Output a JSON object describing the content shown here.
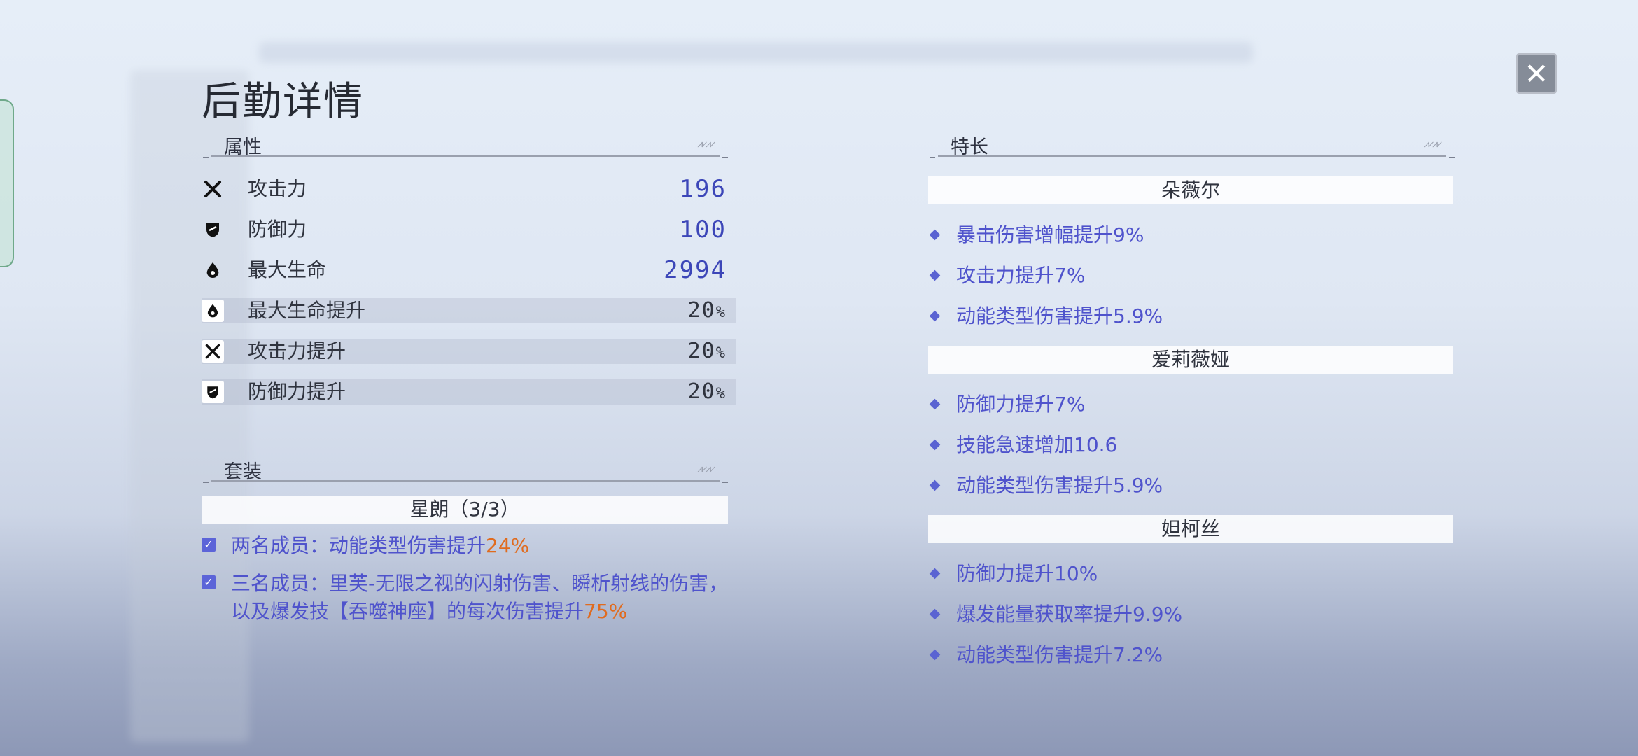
{
  "page_title": "后勤详情",
  "close_icon": "close-icon",
  "attributes": {
    "heading": "属性",
    "stats": [
      {
        "icon": "attack-icon",
        "label": "攻击力",
        "value": "196"
      },
      {
        "icon": "defense-icon",
        "label": "防御力",
        "value": "100"
      },
      {
        "icon": "hp-icon",
        "label": "最大生命",
        "value": "2994"
      },
      {
        "icon": "hp-icon",
        "label": "最大生命提升",
        "value": "20",
        "unit": "%"
      },
      {
        "icon": "attack-icon",
        "label": "攻击力提升",
        "value": "20",
        "unit": "%"
      },
      {
        "icon": "defense-icon",
        "label": "防御力提升",
        "value": "20",
        "unit": "%"
      }
    ]
  },
  "set": {
    "heading": "套装",
    "name": "星朗（3/3）",
    "bonuses": [
      {
        "text": "两名成员：动能类型伤害提升",
        "highlight": "24%"
      },
      {
        "text": "三名成员：里芙-无限之视的闪射伤害、瞬析射线的伤害，以及爆发技【吞噬神座】的每次伤害提升",
        "highlight": "75%"
      }
    ]
  },
  "specialties": {
    "heading": "特长",
    "characters": [
      {
        "name": "朵薇尔",
        "traits": [
          "暴击伤害增幅提升9%",
          "攻击力提升7%",
          "动能类型伤害提升5.9%"
        ]
      },
      {
        "name": "爱莉薇娅",
        "traits": [
          "防御力提升7%",
          "技能急速增加10.6",
          "动能类型伤害提升5.9%"
        ]
      },
      {
        "name": "妲柯丝",
        "traits": [
          "防御力提升10%",
          "爆发能量获取率提升9.9%",
          "动能类型伤害提升7.2%"
        ]
      }
    ]
  },
  "colors": {
    "accent": "#4f53cc",
    "highlight": "#e06b1e",
    "value": "#3c46b8"
  }
}
